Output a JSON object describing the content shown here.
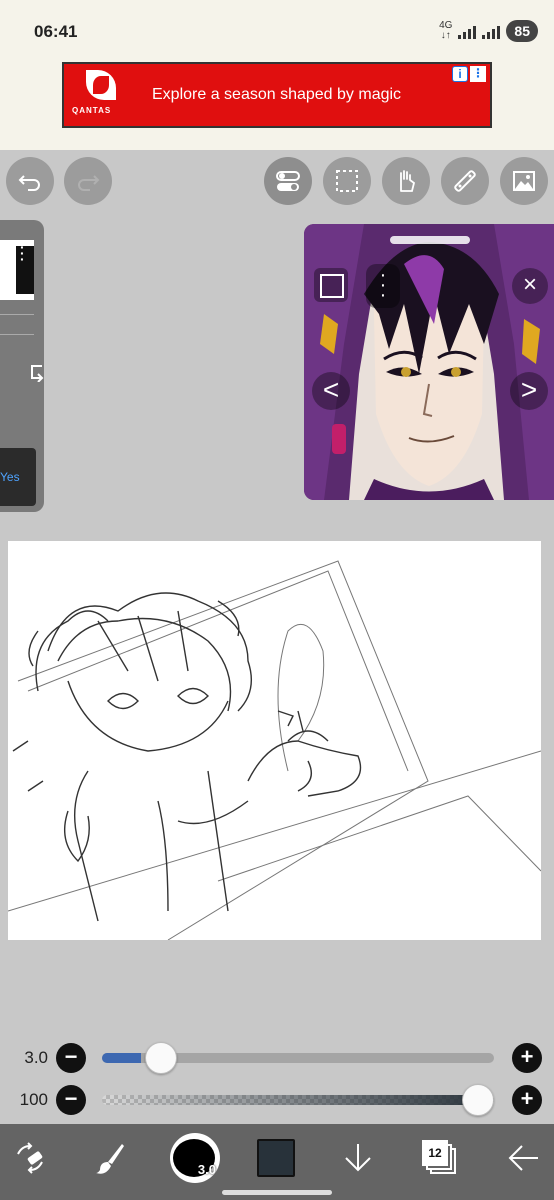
{
  "status_bar": {
    "time": "06:41",
    "network": "4G",
    "battery": "85"
  },
  "ad": {
    "brand": "QANTAS",
    "text": "Explore a season shaped by magic",
    "info_icon": "i",
    "menu_icon": "⋮"
  },
  "toolbar": {
    "tools": [
      "undo-icon",
      "redo-icon",
      "toggle-icon",
      "selection-icon",
      "hand-icon",
      "ruler-icon",
      "image-icon"
    ]
  },
  "side_panel": {
    "yes_label": "Yes"
  },
  "reference_panel": {
    "close_icon": "×",
    "prev_icon": "<",
    "next_icon": ">"
  },
  "sliders": {
    "size": {
      "value": "3.0",
      "fill_fraction": 0.1
    },
    "opacity": {
      "value": "100",
      "fill_fraction": 1.0
    },
    "minus_label": "−",
    "plus_label": "+"
  },
  "bottom_bar": {
    "brush_size": "3.0",
    "layer_count": "12",
    "color": "#28323a"
  },
  "colors": {
    "accent": "#3d68b1",
    "ad_red": "#e00f0f",
    "toolbar_bg": "#646464"
  }
}
